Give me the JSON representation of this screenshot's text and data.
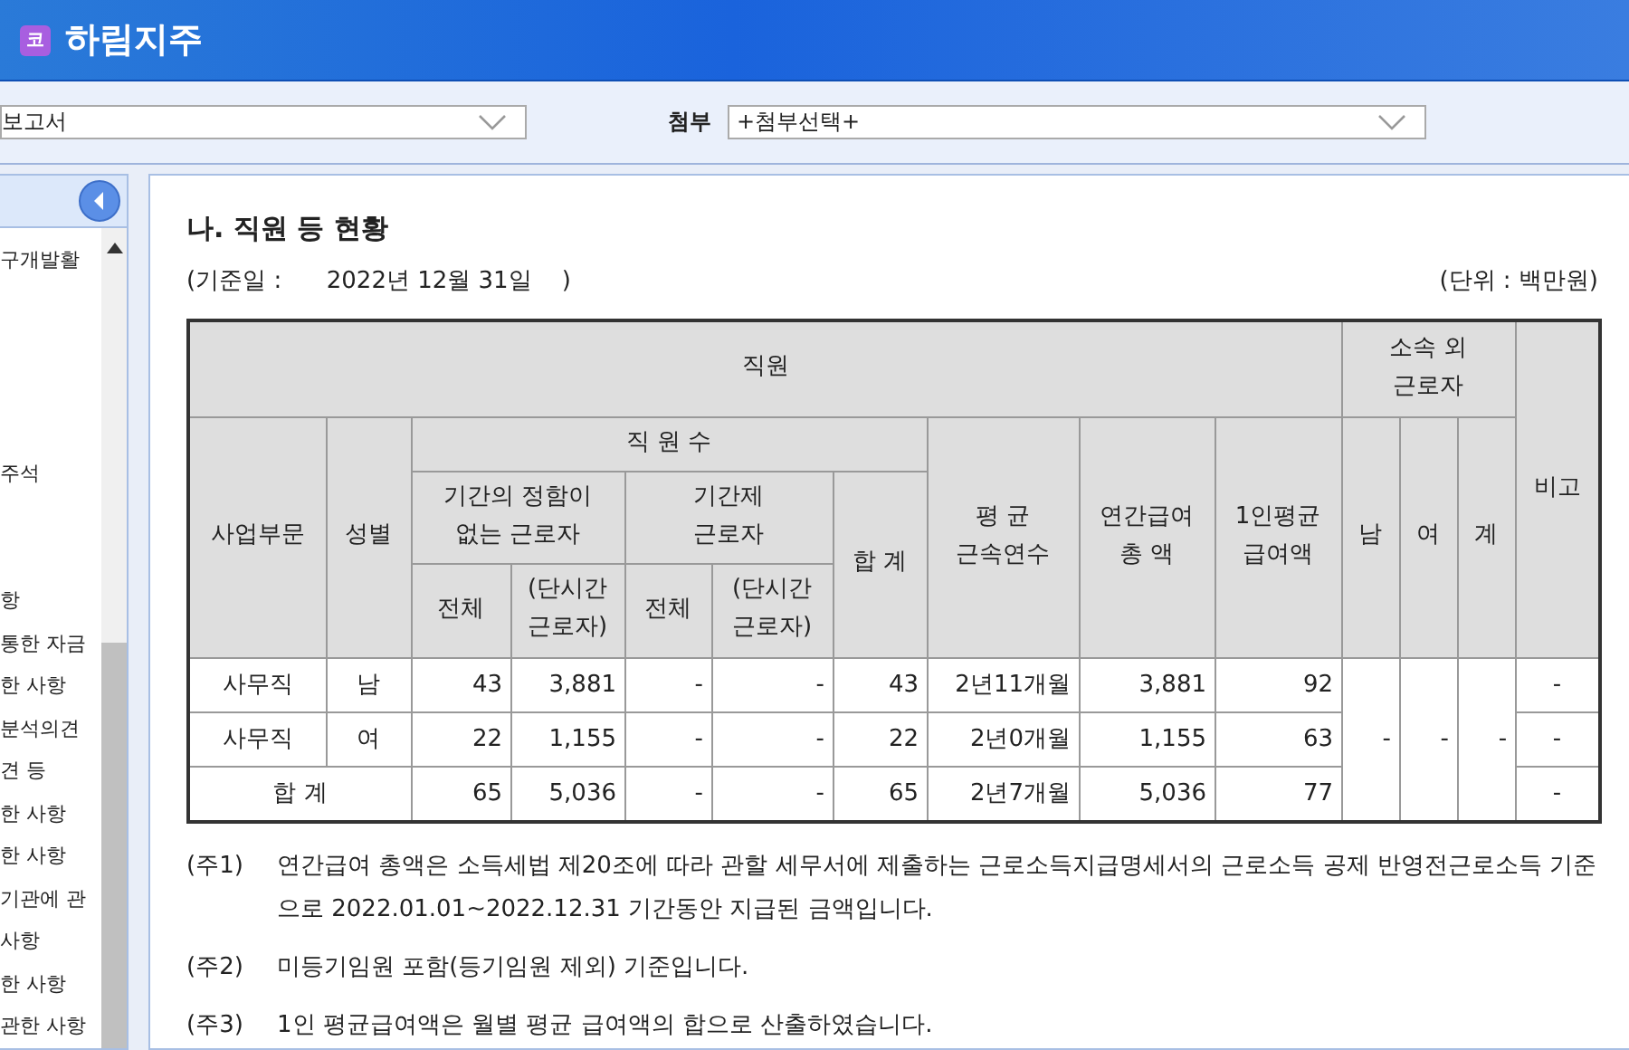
{
  "window": {
    "app_icon": "코",
    "title": "하림지주"
  },
  "toolbar": {
    "report_select": {
      "value": "보고서"
    },
    "attach_label": "첨부",
    "attach_select": {
      "value": "+첨부선택+"
    }
  },
  "sidebar": {
    "items": [
      "구개발활",
      "주석",
      "항",
      "통한 자금",
      "한 사항",
      "분석의견",
      "견 등",
      "한 사항",
      "한 사항",
      "기관에 관",
      "사항",
      "한 사항",
      "관한 사항"
    ]
  },
  "section": {
    "title": "나. 직원 등 현황",
    "base_date": "(기준일 :      2022년 12월 31일    )",
    "unit": "(단위 : 백만원)"
  },
  "table": {
    "headers": {
      "staff": "직원",
      "outside": "소속 외\n근로자",
      "remarks": "비고",
      "division": "사업부문",
      "gender": "성별",
      "headcount": "직 원 수",
      "permanent": "기간의 정함이\n없는 근로자",
      "fixed_term": "기간제\n근로자",
      "total": "합 계",
      "tenure": "평 균\n근속연수",
      "annual_pay": "연간급여\n총 액",
      "avg_pay": "1인평균\n급여액",
      "male": "남",
      "female": "여",
      "sum": "계",
      "perm_all": "전체",
      "perm_part": "(단시간\n근로자)",
      "fixed_all": "전체",
      "fixed_part": "(단시간\n근로자)"
    },
    "rows": [
      {
        "kind": "data",
        "division": "사무직",
        "gender": "남",
        "cells": [
          "43",
          "3,881",
          "-",
          "-",
          "43",
          "2년11개월",
          "3,881",
          "92"
        ],
        "remarks": "-"
      },
      {
        "kind": "data",
        "division": "사무직",
        "gender": "여",
        "cells": [
          "22",
          "1,155",
          "-",
          "-",
          "22",
          "2년0개월",
          "1,155",
          "63"
        ],
        "remarks": "-"
      },
      {
        "kind": "total",
        "label": "합 계",
        "cells": [
          "65",
          "5,036",
          "-",
          "-",
          "65",
          "2년7개월",
          "5,036",
          "77"
        ],
        "remarks": "-"
      }
    ],
    "outside": [
      "-",
      "-",
      "-"
    ]
  },
  "notes": [
    {
      "mark": "(주1)",
      "text": "연간급여 총액은 소득세법 제20조에 따라 관할 세무서에 제출하는 근로소득지급명세서의 근로소득 공제 반영전근로소득 기준으로 2022.01.01~2022.12.31 기간동안 지급된 금액입니다."
    },
    {
      "mark": "(주2)",
      "text": "미등기임원 포함(등기임원 제외) 기준입니다."
    },
    {
      "mark": "(주3)",
      "text": "1인 평균급여액은 월별 평균 급여액의 합으로 산출하였습니다."
    }
  ]
}
